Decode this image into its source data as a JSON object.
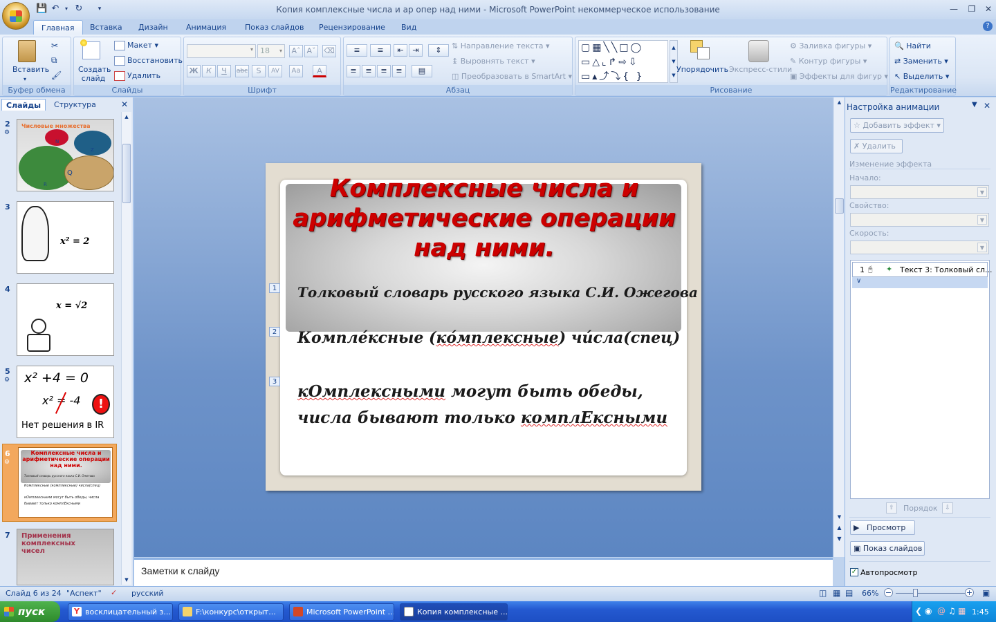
{
  "window": {
    "title": "Копия комплексные числа и ар опер над ними - Microsoft PowerPoint некоммерческое использование"
  },
  "tabs": [
    {
      "label": "Главная",
      "active": true
    },
    {
      "label": "Вставка"
    },
    {
      "label": "Дизайн"
    },
    {
      "label": "Анимация"
    },
    {
      "label": "Показ слайдов"
    },
    {
      "label": "Рецензирование"
    },
    {
      "label": "Вид"
    }
  ],
  "ribbon": {
    "clipboard": {
      "label": "Буфер обмена",
      "paste": "Вставить"
    },
    "slides": {
      "label": "Слайды",
      "new_slide": "Создать слайд",
      "layout": "Макет",
      "reset": "Восстановить",
      "delete": "Удалить"
    },
    "font": {
      "label": "Шрифт",
      "size": "18"
    },
    "paragraph": {
      "label": "Абзац",
      "text_direction": "Направление текста",
      "align_text": "Выровнять текст",
      "smartart": "Преобразовать в SmartArt"
    },
    "drawing": {
      "label": "Рисование",
      "arrange": "Упорядочить",
      "quick_styles": "Экспресс-стили",
      "fill": "Заливка фигуры",
      "outline": "Контур фигуры",
      "effects": "Эффекты для фигур"
    },
    "editing": {
      "label": "Редактирование",
      "find": "Найти",
      "replace": "Заменить",
      "select": "Выделить"
    }
  },
  "left_pane": {
    "tabs": [
      "Слайды",
      "Структура"
    ],
    "thumbs": [
      {
        "num": "2",
        "title": "Числовые множества",
        "labels": [
          "N",
          "Z",
          "Q",
          "R"
        ]
      },
      {
        "num": "3",
        "formula": "x² = 2"
      },
      {
        "num": "4",
        "formula": "x = √2"
      },
      {
        "num": "5",
        "eq1": "x² +4 = 0",
        "eq2": "x² = -4",
        "caption": "Нет решения в IR"
      },
      {
        "num": "6",
        "title": "Комплексные числа и арифметические операции над ними.",
        "line1": "Толковый словарь русского языка С.И. Ожегова",
        "line2": "Комплексные (комплексные) числа(спец)",
        "line3": "кОмплексными могут быть обеды, числа бывают только комплЕксными"
      },
      {
        "num": "7",
        "title": "Применения комплексных чисел"
      }
    ]
  },
  "slide": {
    "title": "Комплексные числа и арифметические операции над ними.",
    "anim_markers": [
      "1",
      "2",
      "3"
    ],
    "line1": "Толковый словарь русского языка С.И. Ожегова",
    "line2_a": "Компле́ксные (",
    "line2_b": "ко́мплексные",
    "line2_c": ") чи́сла(спец)",
    "line3_a": "кОмплексными",
    "line3_b": " могут быть обеды,",
    "line4_a": "числа бывают только ",
    "line4_b": "комплЕксными"
  },
  "notes": {
    "placeholder": "Заметки к слайду"
  },
  "anim_pane": {
    "title": "Настройка анимации",
    "add_effect": "Добавить эффект",
    "remove": "Удалить",
    "modify": "Изменение эффекта",
    "start_label": "Начало:",
    "property_label": "Свойство:",
    "speed_label": "Скорость:",
    "item_num": "1",
    "item_text": "Текст 3: Толковый сл...",
    "reorder": "Порядок",
    "play": "Просмотр",
    "slideshow": "Показ слайдов",
    "autopreview": "Автопросмотр"
  },
  "status": {
    "slide": "Слайд 6 из 24",
    "theme": "\"Аспект\"",
    "lang": "русский",
    "zoom": "66%"
  },
  "taskbar": {
    "start": "пуск",
    "tasks": [
      "восклицательный з...",
      "F:\\конкурс\\открыт...",
      "Microsoft PowerPoint ...",
      "Копия комплексные ..."
    ],
    "time": "1:45"
  },
  "colors": {
    "title_red": "#cc0000",
    "ribbon_blue": "#bfd3ee",
    "accent_orange": "#f2a43e"
  }
}
